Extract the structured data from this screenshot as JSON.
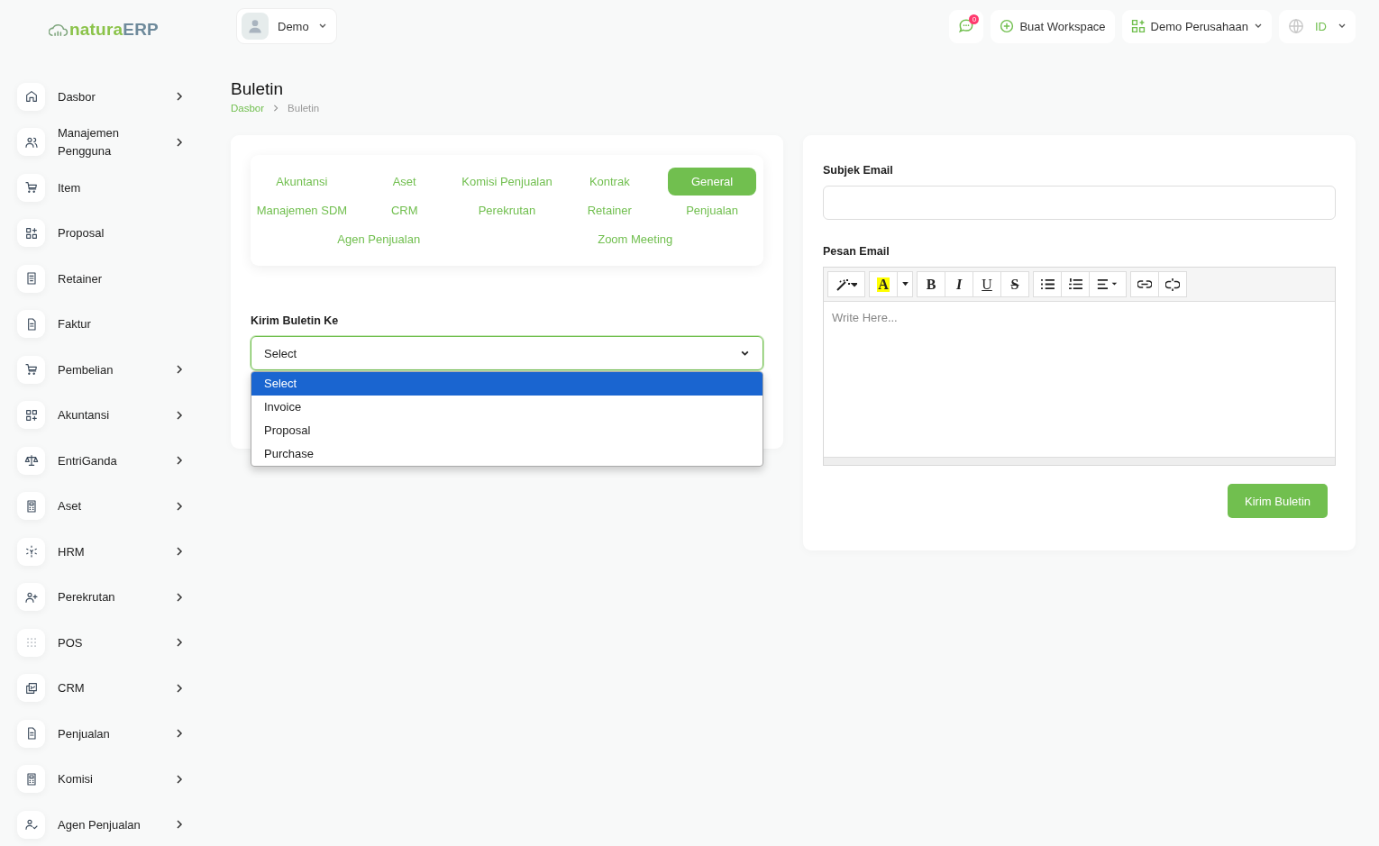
{
  "brand": {
    "part1": "natura",
    "part2": "ERP"
  },
  "header": {
    "user": "Demo",
    "notification_count": "0",
    "create_workspace": "Buat Workspace",
    "company": "Demo Perusahaan",
    "language": "ID"
  },
  "sidebar": {
    "items": [
      {
        "label": "Dasbor",
        "expandable": true
      },
      {
        "label": "Manajemen Pengguna",
        "expandable": true
      },
      {
        "label": "Item",
        "expandable": false
      },
      {
        "label": "Proposal",
        "expandable": false
      },
      {
        "label": "Retainer",
        "expandable": false
      },
      {
        "label": "Faktur",
        "expandable": false
      },
      {
        "label": "Pembelian",
        "expandable": true
      },
      {
        "label": "Akuntansi",
        "expandable": true
      },
      {
        "label": "EntriGanda",
        "expandable": true
      },
      {
        "label": "Aset",
        "expandable": true
      },
      {
        "label": "HRM",
        "expandable": true
      },
      {
        "label": "Perekrutan",
        "expandable": true
      },
      {
        "label": "POS",
        "expandable": true
      },
      {
        "label": "CRM",
        "expandable": true
      },
      {
        "label": "Penjualan",
        "expandable": true
      },
      {
        "label": "Komisi",
        "expandable": true
      },
      {
        "label": "Agen Penjualan",
        "expandable": true
      }
    ]
  },
  "page": {
    "title": "Buletin",
    "breadcrumb": [
      "Dasbor",
      "Buletin"
    ]
  },
  "tabs": [
    {
      "label": "Akuntansi",
      "selected": false
    },
    {
      "label": "Aset",
      "selected": false
    },
    {
      "label": "Komisi Penjualan",
      "selected": false
    },
    {
      "label": "Kontrak",
      "selected": false
    },
    {
      "label": "General",
      "selected": true
    },
    {
      "label": "Manajemen SDM",
      "selected": false
    },
    {
      "label": "CRM",
      "selected": false
    },
    {
      "label": "Perekrutan",
      "selected": false
    },
    {
      "label": "Retainer",
      "selected": false
    },
    {
      "label": "Penjualan",
      "selected": false
    },
    {
      "label": "Agen Penjualan",
      "selected": false
    },
    {
      "label": "Zoom Meeting",
      "selected": false
    }
  ],
  "send_to": {
    "label": "Kirim Buletin Ke",
    "value": "Select",
    "expanded": true,
    "options": [
      {
        "label": "Select",
        "selected": true
      },
      {
        "label": "Invoice",
        "selected": false
      },
      {
        "label": "Proposal",
        "selected": false
      },
      {
        "label": "Purchase",
        "selected": false
      }
    ]
  },
  "email": {
    "subject_label": "Subjek Email",
    "message_label": "Pesan Email",
    "placeholder": "Write Here...",
    "highlight": "A",
    "format_buttons": [
      {
        "kind": "bold",
        "label": "B"
      },
      {
        "kind": "italic",
        "label": "I"
      },
      {
        "kind": "underline",
        "label": "U"
      },
      {
        "kind": "strike",
        "label": "S"
      }
    ],
    "submit": "Kirim Buletin"
  }
}
